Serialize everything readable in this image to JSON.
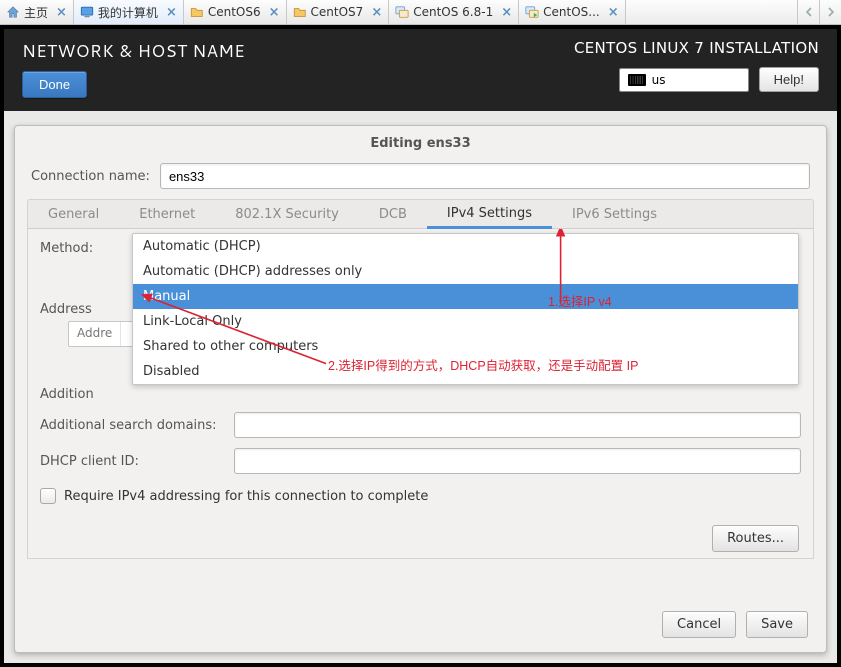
{
  "tabs": {
    "home": "主页",
    "mycomputer": "我的计算机",
    "centos6": "CentOS6",
    "centos7": "CentOS7",
    "centos681": "CentOS 6.8-1",
    "centos_trunc": "CentOS..."
  },
  "header": {
    "title": "NETWORK & HOST NAME",
    "done": "Done",
    "installation": "CENTOS LINUX 7 INSTALLATION",
    "keyboard_layout": "us",
    "help": "Help!"
  },
  "dialog": {
    "title": "Editing ens33",
    "connection_name_label": "Connection name:",
    "connection_name_value": "ens33",
    "tabs": {
      "general": "General",
      "ethernet": "Ethernet",
      "security": "802.1X Security",
      "dcb": "DCB",
      "ipv4": "IPv4 Settings",
      "ipv6": "IPv6 Settings"
    },
    "method_label": "Method:",
    "method_options": {
      "auto": "Automatic (DHCP)",
      "auto_addr": "Automatic (DHCP) addresses only",
      "manual": "Manual",
      "linklocal": "Link-Local Only",
      "shared": "Shared to other computers",
      "disabled": "Disabled"
    },
    "addresses_label_trunc": "Address",
    "addr_col_trunc": "Addre",
    "addition_label_trunc": "Addition",
    "additional_search_label": "Additional search domains:",
    "dhcp_client_label": "DHCP client ID:",
    "require_ipv4_label": "Require IPv4 addressing for this connection to complete",
    "routes_btn": "Routes...",
    "cancel": "Cancel",
    "save": "Save"
  },
  "annotations": {
    "a1": "1.选择IP v4",
    "a2": "2.选择IP得到的方式，DHCP自动获取，还是手动配置 IP"
  }
}
